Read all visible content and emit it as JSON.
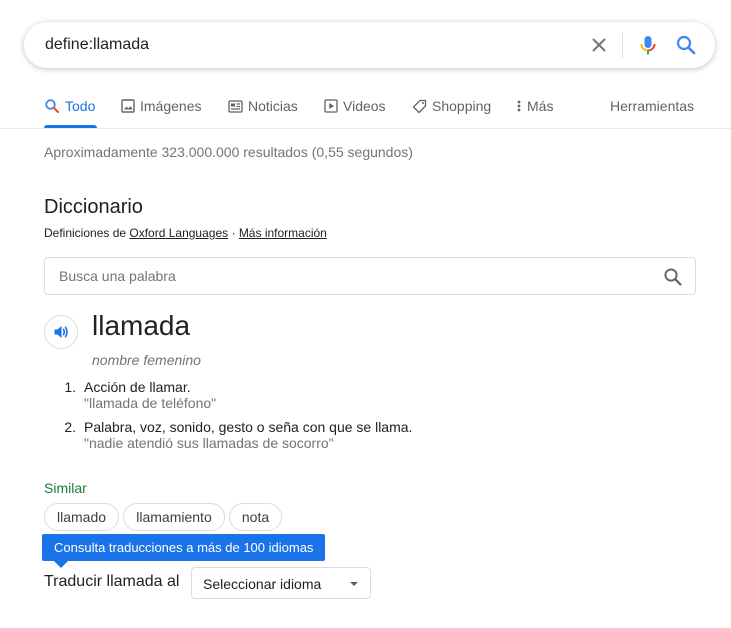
{
  "search": {
    "query": "define:llamada"
  },
  "tabs": [
    {
      "label": "Todo",
      "icon": "search-icon",
      "active": true
    },
    {
      "label": "Imágenes",
      "icon": "image-icon"
    },
    {
      "label": "Noticias",
      "icon": "news-icon"
    },
    {
      "label": "Videos",
      "icon": "play-icon"
    },
    {
      "label": "Shopping",
      "icon": "tag-icon"
    },
    {
      "label": "Más",
      "icon": "more-vert-icon"
    }
  ],
  "tools_label": "Herramientas",
  "result_stats": "Aproximadamente 323.000.000 resultados (0,55 segundos)",
  "dictionary": {
    "title": "Diccionario",
    "source_prefix": "Definiciones de ",
    "source_link": "Oxford Languages",
    "separator": " · ",
    "more_info": "Más información",
    "search_placeholder": "Busca una palabra",
    "word": "llamada",
    "part_of_speech": "nombre femenino",
    "definitions": [
      {
        "number": "1.",
        "text": "Acción de llamar.",
        "example": "\"llamada de teléfono\""
      },
      {
        "number": "2.",
        "text": "Palabra, voz, sonido, gesto o seña con que se llama.",
        "example": "\"nadie atendió sus llamadas de socorro\""
      }
    ],
    "similar_label": "Similar",
    "similar": [
      "llamado",
      "llamamiento",
      "nota"
    ]
  },
  "translate": {
    "tooltip": "Consulta traducciones a más de 100 idiomas",
    "label": "Traducir llamada al",
    "select_value": "Seleccionar idioma"
  },
  "colors": {
    "accent": "#1a73e8",
    "similar_green": "#188038",
    "muted": "#70757a",
    "mic_blue": "#4285f4",
    "mic_red": "#ea4335",
    "mic_yellow": "#fbbc04",
    "mic_green": "#34a853"
  }
}
